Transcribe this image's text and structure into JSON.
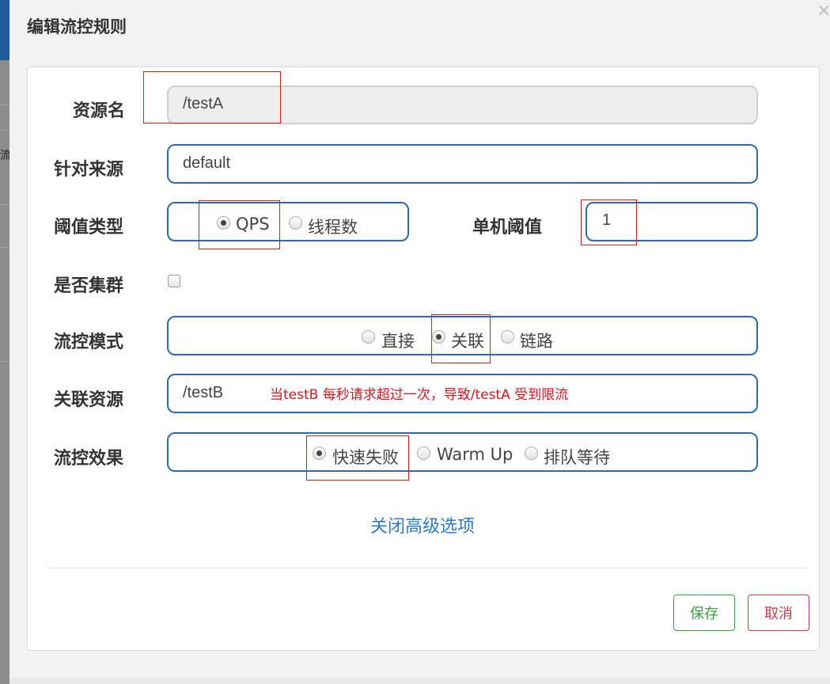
{
  "dialog": {
    "title": "编辑流控规则",
    "close_glyph": "×"
  },
  "form": {
    "resource_name": {
      "label": "资源名",
      "value": "/testA",
      "disabled": true
    },
    "limit_app": {
      "label": "针对来源",
      "value": "default"
    },
    "threshold_type": {
      "label": "阈值类型",
      "options": [
        {
          "label": "QPS",
          "checked": true
        },
        {
          "label": "线程数",
          "checked": false
        }
      ]
    },
    "single_threshold": {
      "label": "单机阈值",
      "value": "1"
    },
    "cluster_mode": {
      "label": "是否集群",
      "checked": false
    },
    "flow_mode": {
      "label": "流控模式",
      "options": [
        {
          "label": "直接",
          "checked": false
        },
        {
          "label": "关联",
          "checked": true
        },
        {
          "label": "链路",
          "checked": false
        }
      ]
    },
    "ref_resource": {
      "label": "关联资源",
      "value": "/testB"
    },
    "control_behavior": {
      "label": "流控效果",
      "options": [
        {
          "label": "快速失败",
          "checked": true
        },
        {
          "label": "Warm Up",
          "checked": false
        },
        {
          "label": "排队等待",
          "checked": false
        }
      ]
    },
    "advanced_toggle": "关闭高级选项"
  },
  "annotation": {
    "text": "当testB 每秒请求超过一次，导致/testA 受到限流",
    "color": "#e0141e"
  },
  "buttons": {
    "save": "保存",
    "cancel": "取消"
  },
  "colors": {
    "input_border": "#2c6cae",
    "link": "#2f7ac8",
    "save": "#3a9b44",
    "cancel": "#d23a45",
    "highlight_box": "#d42020"
  },
  "backdrop": {
    "glyph": "流"
  }
}
